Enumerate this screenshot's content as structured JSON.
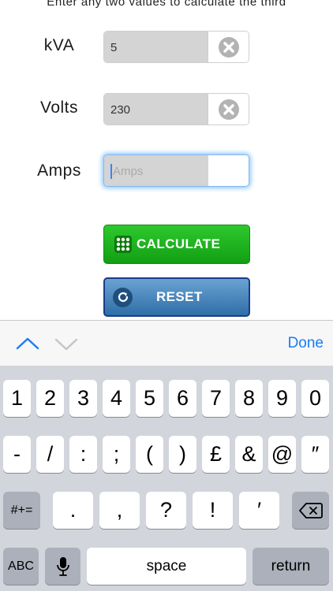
{
  "instruction": "Enter any two values to calculate the third",
  "fields": [
    {
      "label": "kVA",
      "value": "5",
      "placeholder": ""
    },
    {
      "label": "Volts",
      "value": "230",
      "placeholder": ""
    },
    {
      "label": "Amps",
      "value": "",
      "placeholder": "Amps"
    }
  ],
  "buttons": {
    "calculate": "CALCULATE",
    "reset": "RESET"
  },
  "toolbar": {
    "done": "Done"
  },
  "keyboard": {
    "row1": [
      "1",
      "2",
      "3",
      "4",
      "5",
      "6",
      "7",
      "8",
      "9",
      "0"
    ],
    "row2": [
      "-",
      "/",
      ":",
      ";",
      "(",
      ")",
      "£",
      "&",
      "@",
      "″"
    ],
    "row3": {
      "mode": "#+=",
      "keys": [
        ".",
        ",",
        "?",
        "!",
        "′"
      ]
    },
    "row4": {
      "abc": "ABC",
      "space": "space",
      "return": "return"
    }
  }
}
